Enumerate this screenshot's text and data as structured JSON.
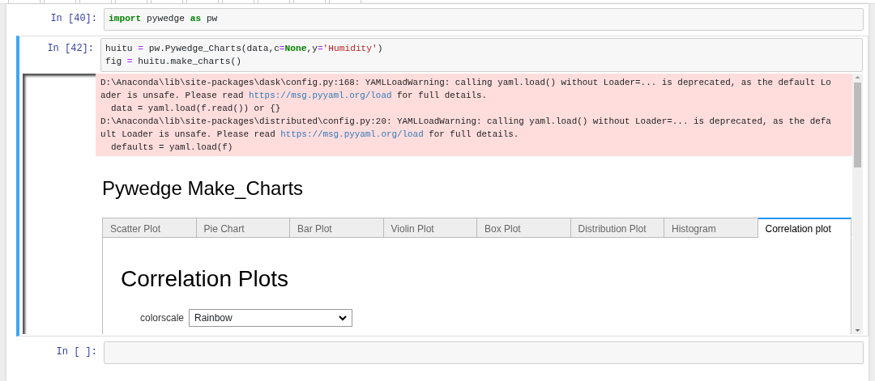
{
  "cells": [
    {
      "prompt": "In [40]:",
      "selected": false,
      "code": [
        [
          {
            "text": "import",
            "kind": "keyword"
          },
          {
            "text": " pywedge ",
            "kind": "plain"
          },
          {
            "text": "as",
            "kind": "keyword"
          },
          {
            "text": " pw",
            "kind": "plain"
          }
        ]
      ]
    },
    {
      "prompt": "In [42]:",
      "selected": true,
      "code": [
        [
          {
            "text": "huitu ",
            "kind": "plain"
          },
          {
            "text": "=",
            "kind": "operator"
          },
          {
            "text": " pw.Pywedge_Charts(data,c",
            "kind": "plain"
          },
          {
            "text": "=",
            "kind": "operator"
          },
          {
            "text": "None",
            "kind": "keyword"
          },
          {
            "text": ",y",
            "kind": "plain"
          },
          {
            "text": "=",
            "kind": "operator"
          },
          {
            "text": "'Humidity'",
            "kind": "string"
          },
          {
            "text": ")",
            "kind": "plain"
          }
        ],
        [
          {
            "text": "fig ",
            "kind": "plain"
          },
          {
            "text": "=",
            "kind": "operator"
          },
          {
            "text": " huitu.make_charts()",
            "kind": "plain"
          }
        ]
      ],
      "output": {
        "stderr": [
          [
            {
              "text": "D:\\Anaconda\\lib\\site-packages\\dask\\config.py:168: YAMLLoadWarning: calling yaml.load() without Loader=... is deprecated, as the default Lo",
              "kind": "text"
            }
          ],
          [
            {
              "text": "ader is unsafe. Please read ",
              "kind": "text"
            },
            {
              "text": "https://msg.pyyaml.org/load",
              "kind": "link"
            },
            {
              "text": " for full details.",
              "kind": "text"
            }
          ],
          [
            {
              "text": "  data = yaml.load(f.read()) or {}",
              "kind": "text"
            }
          ],
          [
            {
              "text": "D:\\Anaconda\\lib\\site-packages\\distributed\\config.py:20: YAMLLoadWarning: calling yaml.load() without Loader=... is deprecated, as the defa",
              "kind": "text"
            }
          ],
          [
            {
              "text": "ult Loader is unsafe. Please read ",
              "kind": "text"
            },
            {
              "text": "https://msg.pyyaml.org/load",
              "kind": "link"
            },
            {
              "text": " for full details.",
              "kind": "text"
            }
          ],
          [
            {
              "text": "  defaults = yaml.load(f)",
              "kind": "text"
            }
          ]
        ],
        "widget": {
          "title": "Pywedge Make_Charts",
          "tabs": [
            {
              "label": "Scatter Plot",
              "selected": false
            },
            {
              "label": "Pie Chart",
              "selected": false
            },
            {
              "label": "Bar Plot",
              "selected": false
            },
            {
              "label": "Violin Plot",
              "selected": false
            },
            {
              "label": "Box Plot",
              "selected": false
            },
            {
              "label": "Distribution Plot",
              "selected": false
            },
            {
              "label": "Histogram",
              "selected": false
            },
            {
              "label": "Correlation plot",
              "selected": true
            }
          ],
          "panel": {
            "heading": "Correlation Plots",
            "field_label": "colorscale",
            "field_value": "Rainbow"
          }
        }
      }
    },
    {
      "prompt": "In [ ]:",
      "selected": false
    }
  ]
}
